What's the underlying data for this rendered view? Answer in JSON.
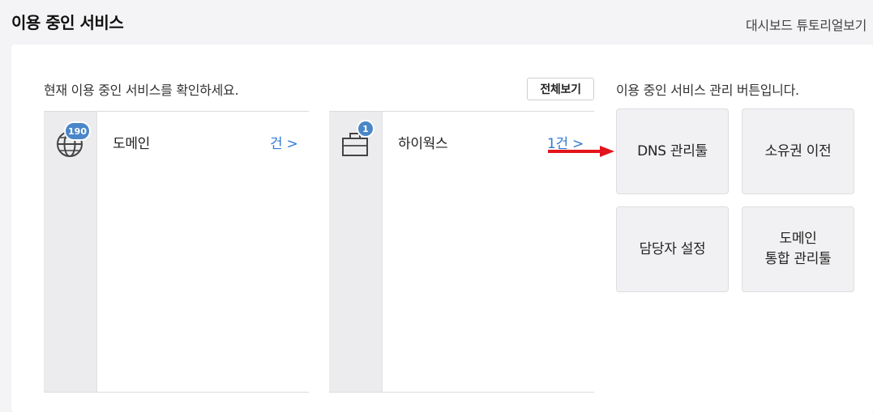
{
  "header": {
    "title": "이용 중인 서비스",
    "tutorial_link": "대시보드 튜토리얼보기"
  },
  "main": {
    "intro": "현재 이용 중인 서비스를 확인하세요.",
    "view_all_label": "전체보기",
    "management_intro": "이용 중인 서비스 관리 버튼입니다."
  },
  "services": [
    {
      "label": "도메인",
      "badge": "190",
      "count_text": "건 >",
      "icon": "globe-icon"
    },
    {
      "label": "하이웍스",
      "badge": "1",
      "count_text": "1건 >",
      "icon": "briefcase-icon"
    }
  ],
  "tools": [
    {
      "line1": "DNS 관리툴",
      "line2": ""
    },
    {
      "line1": "소유권 이전",
      "line2": ""
    },
    {
      "line1": "담당자 설정",
      "line2": ""
    },
    {
      "line1": "도메인",
      "line2": "통합 관리툴"
    }
  ],
  "colors": {
    "accent_blue": "#2f7bd6",
    "badge_blue": "#4a86c8",
    "arrow_red": "#e3141b"
  }
}
